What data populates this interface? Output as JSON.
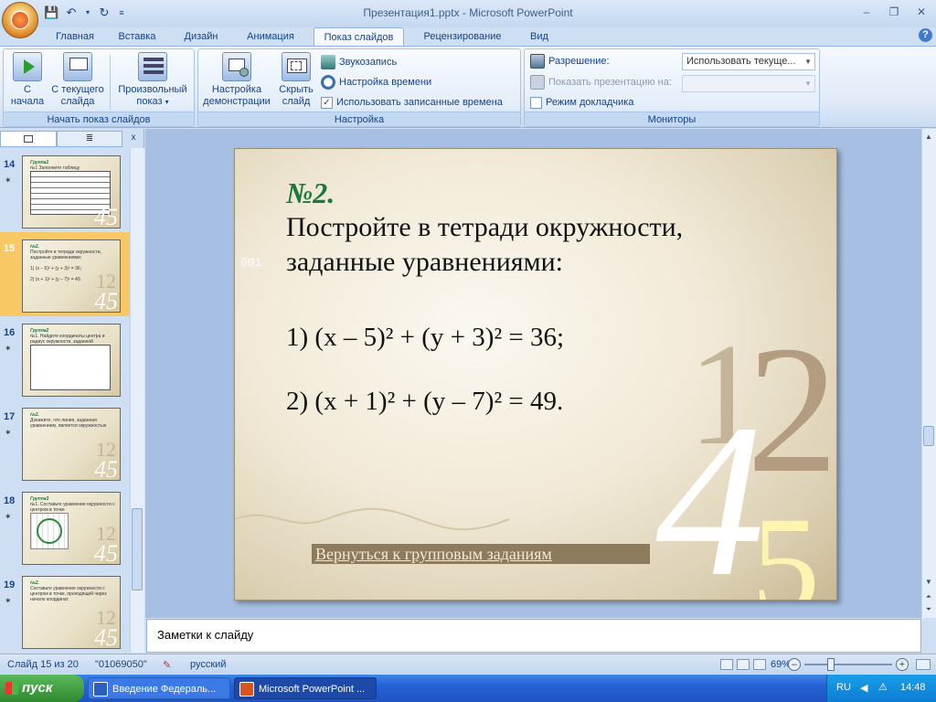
{
  "window": {
    "title": "Презентация1.pptx - Microsoft PowerPoint"
  },
  "tabs": [
    "Главная",
    "Вставка",
    "Дизайн",
    "Анимация",
    "Показ слайдов",
    "Рецензирование",
    "Вид"
  ],
  "active_tab": "Показ слайдов",
  "ribbon": {
    "start_group": {
      "label": "Начать показ слайдов",
      "from_start": "С начала",
      "from_start_l1": "С",
      "from_start_l2": "начала",
      "from_current_l1": "С текущего",
      "from_current_l2": "слайда",
      "custom_l1": "Произвольный",
      "custom_l2": "показ"
    },
    "setup_group": {
      "label": "Настройка",
      "setup_l1": "Настройка",
      "setup_l2": "демонстрации",
      "hide_l1": "Скрыть",
      "hide_l2": "слайд",
      "record": "Звукозапись",
      "timing": "Настройка времени",
      "use_timings": "Использовать записанные времена"
    },
    "monitors_group": {
      "label": "Мониторы",
      "resolution_label": "Разрешение:",
      "resolution_value": "Использовать текуще...",
      "show_on_label": "Показать презентацию на:",
      "presenter_view": "Режим докладчика"
    }
  },
  "thumbnails": [
    {
      "num": "14",
      "title": "Группа1",
      "line": "№1 Заполните таблицу"
    },
    {
      "num": "15",
      "title": "№2.",
      "line": "Постройте в тетради окружности, заданные уравнениями:",
      "eq1": "1) (x – 5)² + (y + 3)² = 36;",
      "eq2": "2) (x + 1)² + (y – 7)² = 49."
    },
    {
      "num": "16",
      "title": "Группа2",
      "line": "№1. Найдите координаты центра и радиус окружности, заданной уравнением"
    },
    {
      "num": "17",
      "title": "№2.",
      "line": "Докажите, что линия, заданная уравнением, является окружностью"
    },
    {
      "num": "18",
      "title": "Группа3",
      "line": "№1. Составьте уравнение окружности с центром в точке"
    },
    {
      "num": "19",
      "title": "№2.",
      "line": "Составьте уравнение окружности с центром в точке, проходящей через начало координат"
    }
  ],
  "slide": {
    "number_label": "№2.",
    "line1": "Постройте в тетради окружности,",
    "line2": "заданные уравнениями:",
    "eq1": "1)  (x – 5)² + (y + 3)² = 36;",
    "eq2": "2) (x + 1)² + (y – 7)² = 49.",
    "side_code": "001",
    "back_link": "Вернуться к групповым заданиям",
    "deco_1": "1",
    "deco_2": "2",
    "deco_4": "4",
    "deco_5": "5"
  },
  "notes": {
    "placeholder": "Заметки к слайду"
  },
  "status": {
    "slide": "Слайд 15 из 20",
    "theme": "\"01069050\"",
    "language": "русский",
    "zoom": "69%"
  },
  "taskbar": {
    "start": "пуск",
    "tasks": [
      "Введение Федераль...",
      "Microsoft PowerPoint ..."
    ],
    "lang": "RU",
    "time": "14:48"
  }
}
